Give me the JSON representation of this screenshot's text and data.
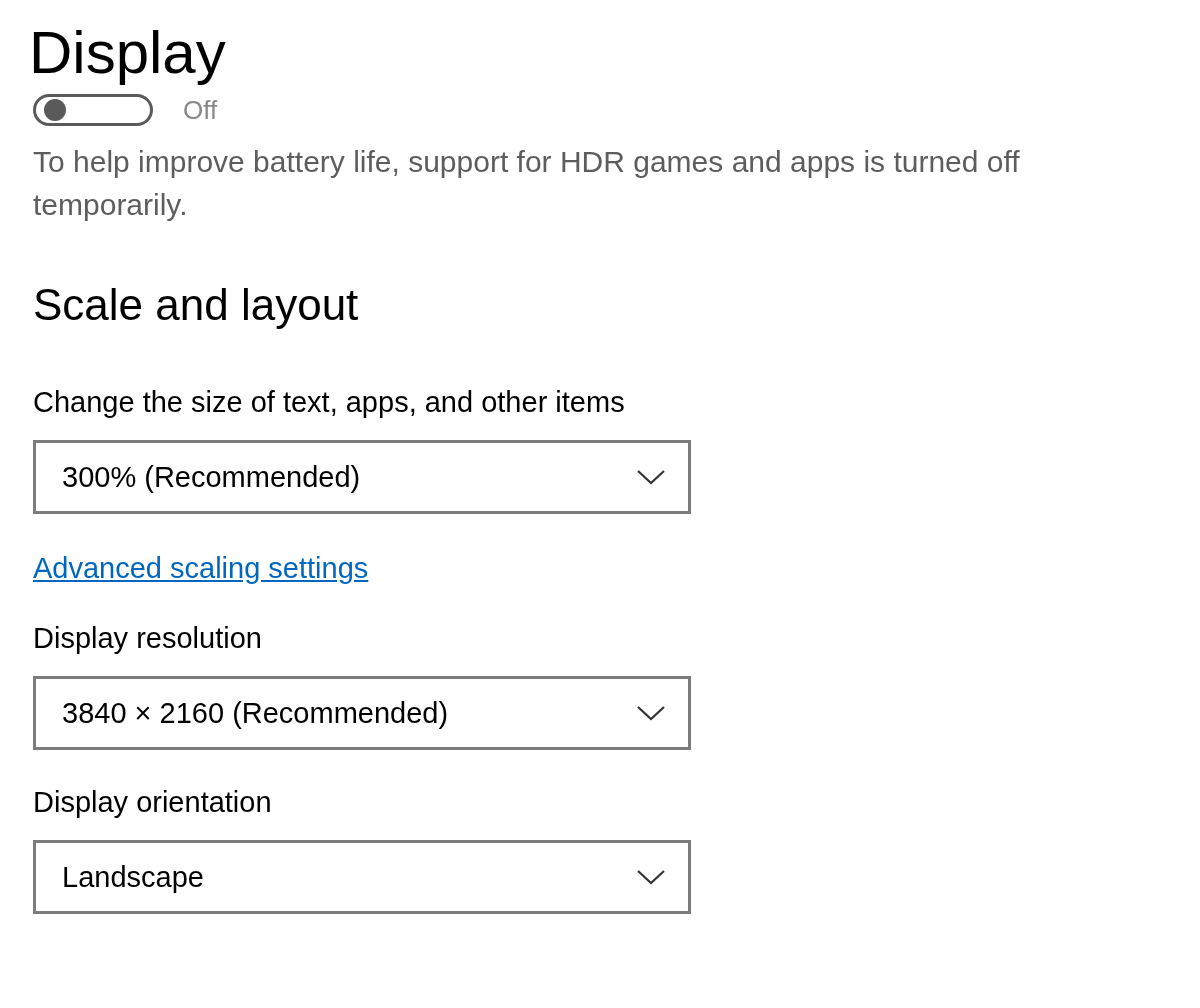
{
  "title": "Display",
  "hdr": {
    "on": false,
    "state_label": "Off",
    "note": "To help improve battery life, support for HDR games and apps is turned off temporarily."
  },
  "section": "Scale and layout",
  "settings": [
    {
      "kind": "dropdown",
      "label": "Change the size of text, apps, and other items",
      "value": "300% (Recommended)"
    },
    {
      "kind": "link",
      "text": "Advanced scaling settings"
    },
    {
      "kind": "dropdown",
      "label": "Display resolution",
      "value": "3840 × 2160 (Recommended)"
    },
    {
      "kind": "dropdown",
      "label": "Display orientation",
      "value": "Landscape"
    }
  ]
}
